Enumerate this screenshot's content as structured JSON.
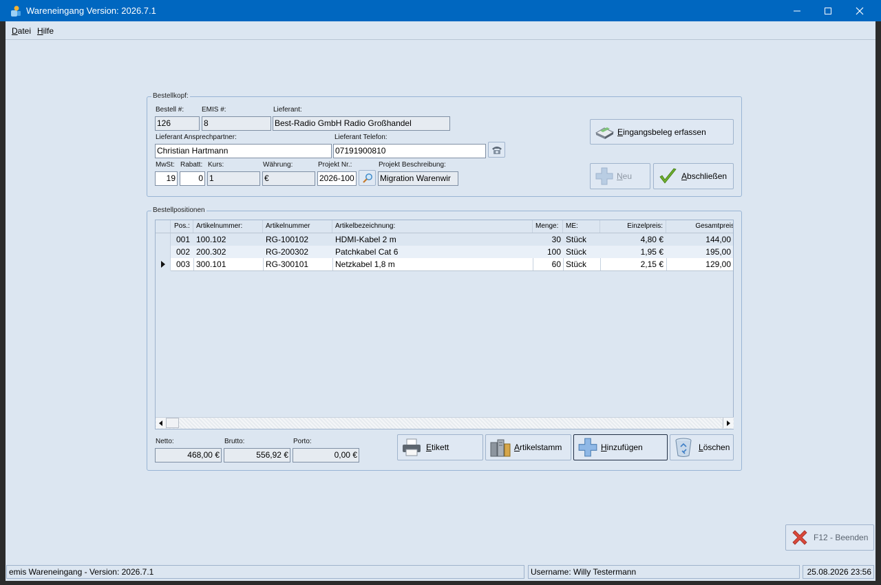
{
  "window": {
    "title": "Wareneingang Version: 2026.7.1",
    "accent": "#0067c0",
    "background": "#dce6f1"
  },
  "menu": {
    "items": [
      "Datei",
      "Hilfe"
    ]
  },
  "bestellkopf": {
    "group_title": "Bestellkopf:",
    "labels": {
      "bestell_nr": "Bestell #:",
      "emis_nr": "EMIS #:",
      "lieferant": "Lieferant:",
      "ansprechpartner": "Lieferant Ansprechpartner:",
      "telefon": "Lieferant Telefon:",
      "mwst": "MwSt:",
      "rabatt": "Rabatt:",
      "kurs": "Kurs:",
      "waehrung": "Währung:",
      "projekt_nr": "Projekt Nr.:",
      "projekt_beschreibung": "Projekt Beschreibung:"
    },
    "values": {
      "bestell_nr": "126",
      "emis_nr": "8",
      "lieferant": "Best-Radio GmbH Radio Großhandel",
      "ansprechpartner": "Christian Hartmann",
      "telefon": "07191900810",
      "mwst": "19",
      "rabatt": "0",
      "kurs": "1",
      "waehrung": "€",
      "projekt_nr": "2026-100",
      "projekt_beschreibung": "Migration Warenwir"
    },
    "buttons": {
      "eingangsbeleg": "Eingangsbeleg erfassen",
      "neu": "Neu",
      "abschliessen": "Abschließen"
    }
  },
  "positionen": {
    "group_title": "Bestellpositionen",
    "columns": [
      "Pos.:",
      "Artikelnummer:",
      "Artikelnummer",
      "Artikelbezeichnung:",
      "Menge:",
      "ME:",
      "Einzelpreis:",
      "Gesamtpreis"
    ],
    "rows": [
      [
        "001",
        "100.102",
        "RG-100102",
        "HDMI-Kabel 2 m",
        "30",
        "Stück",
        "4,80 €",
        "144,00"
      ],
      [
        "002",
        "200.302",
        "RG-200302",
        "Patchkabel Cat 6",
        "100",
        "Stück",
        "1,95 €",
        "195,00"
      ],
      [
        "003",
        "300.101",
        "RG-300101",
        "Netzkabel 1,8 m",
        "60",
        "Stück",
        "2,15 €",
        "129,00"
      ]
    ],
    "selected_row": 2
  },
  "totals": {
    "netto_label": "Netto:",
    "brutto_label": "Brutto:",
    "porto_label": "Porto:",
    "netto": "468,00 €",
    "brutto": "556,92 €",
    "porto": "0,00 €"
  },
  "actions": {
    "etikett": "Etikett",
    "artikelstamm": "Artikelstamm",
    "hinzufuegen": "Hinzufügen",
    "loeschen": "Löschen",
    "beenden": "F12 - Beenden"
  },
  "statusbar": {
    "version": "emis Wareneingang - Version: 2026.7.1",
    "user": "Username: Willy Testermann",
    "datetime": "25.08.2026 23:56"
  }
}
